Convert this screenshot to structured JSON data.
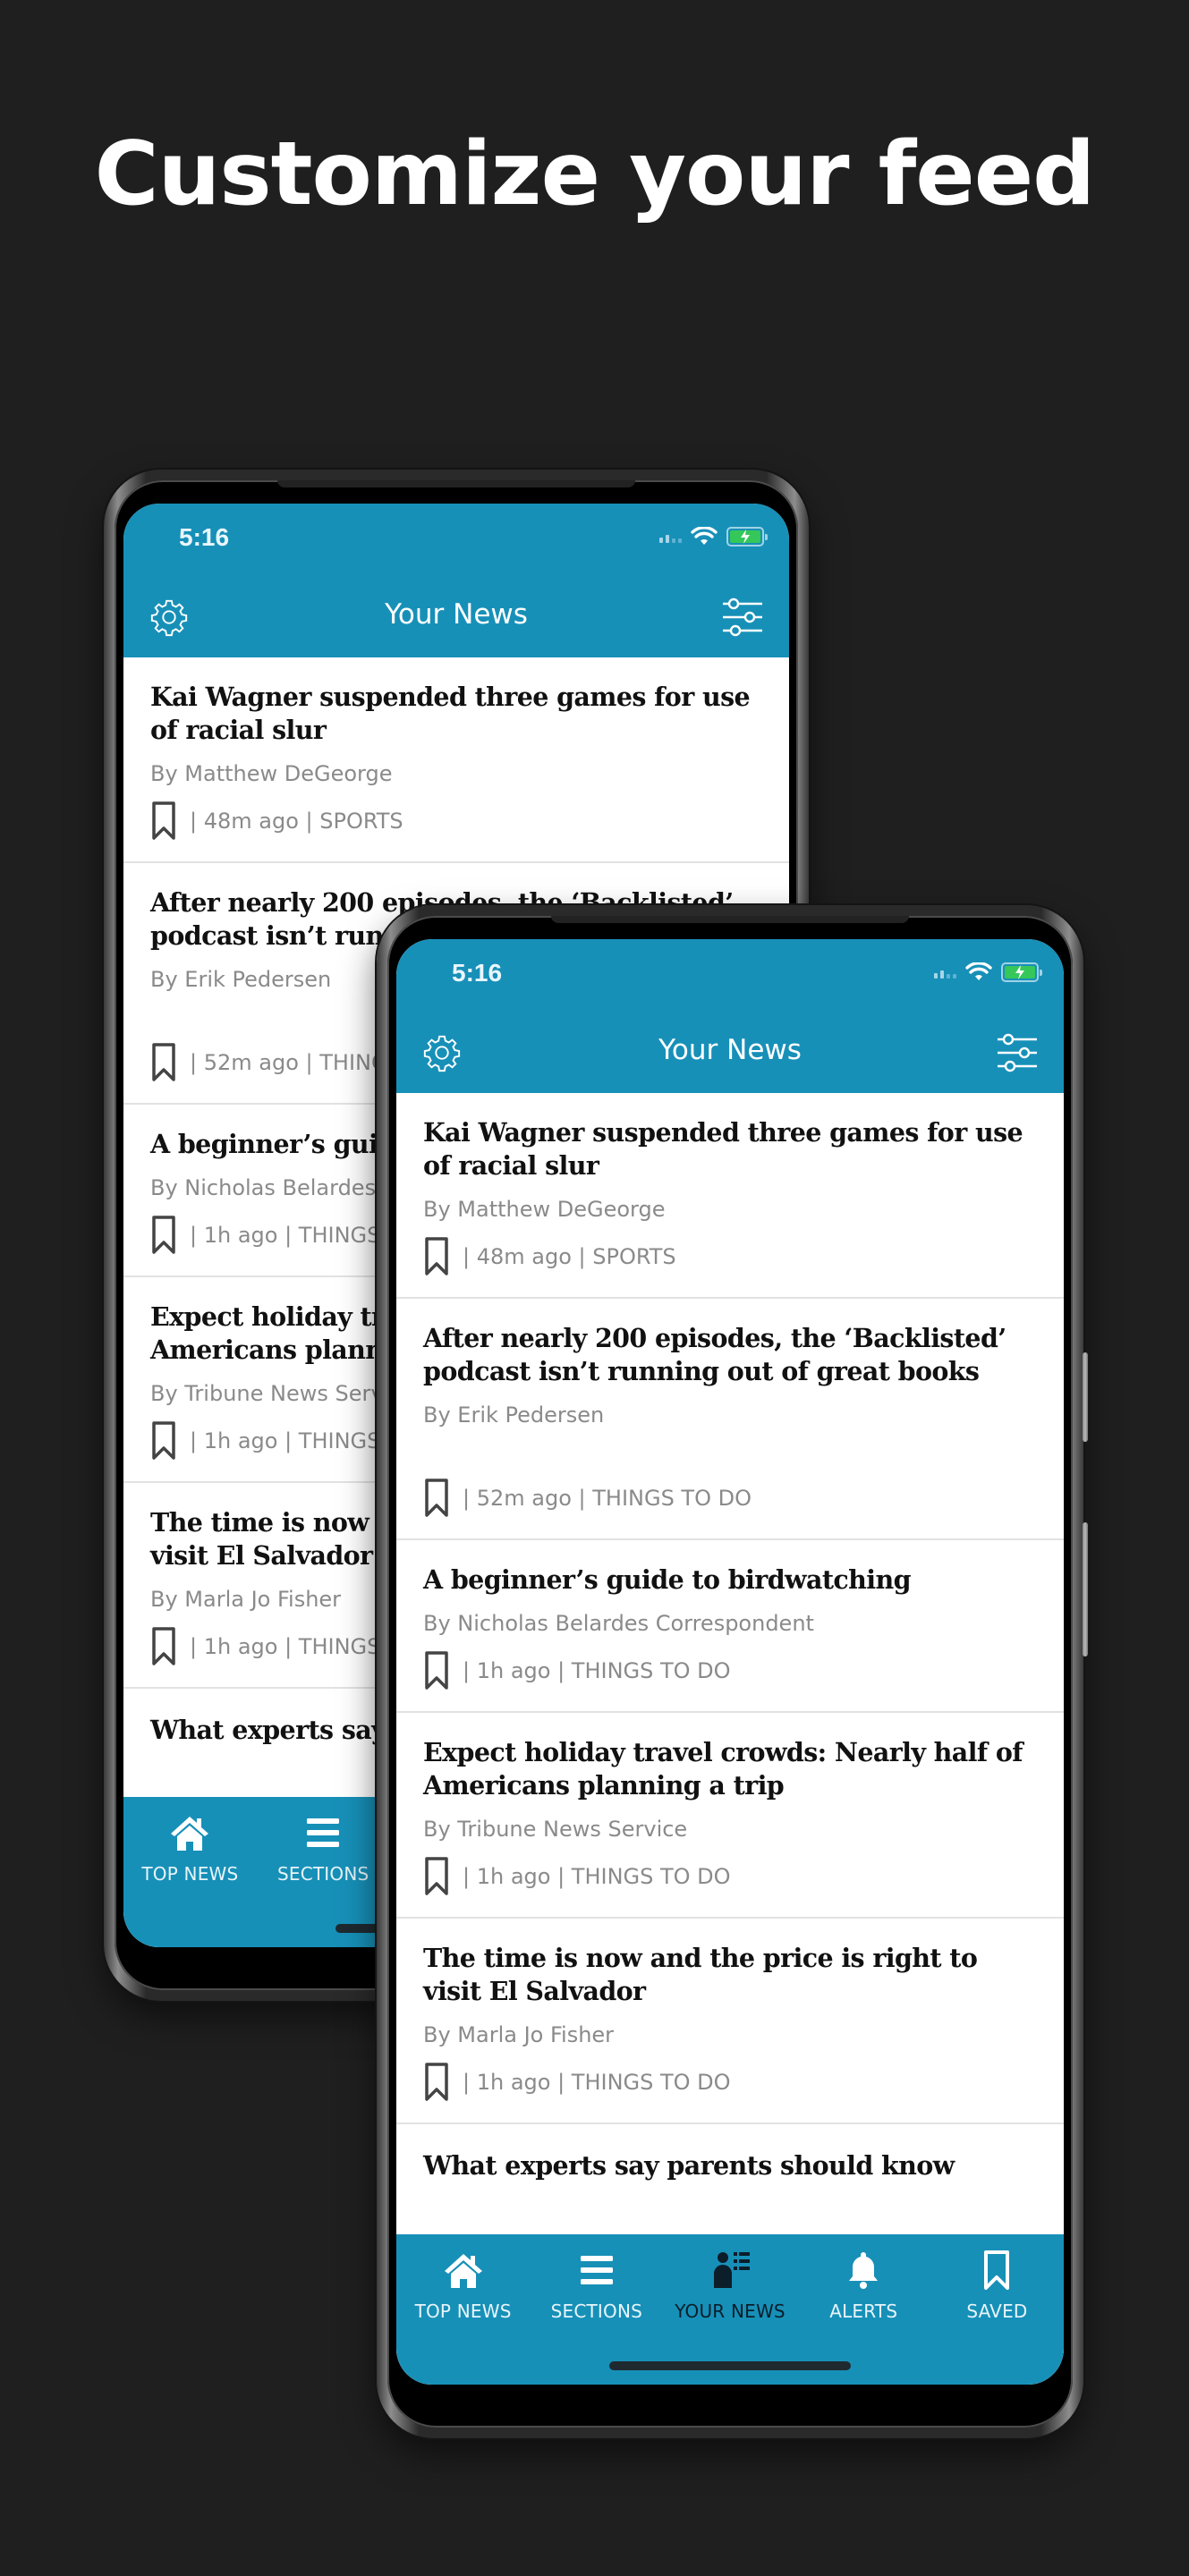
{
  "headline": "Customize your feed",
  "app": {
    "status_time": "5:16",
    "header_title": "Your News",
    "settings_icon": "gear-icon",
    "filter_icon": "sliders-icon",
    "colors": {
      "brand": "#1790b8",
      "background": "#201f20",
      "battery": "#35c759",
      "meta_text": "#8a8a8a",
      "active_tab_text": "#0b1e2a"
    }
  },
  "articles": [
    {
      "title": "Kai Wagner suspended three games for use of racial slur",
      "byline": "By Matthew DeGeorge",
      "meta": "| 48m ago | SPORTS"
    },
    {
      "title": "After nearly 200 episodes, the ‘Backlisted’ podcast isn’t running out of great books",
      "byline": "By Erik Pedersen",
      "meta": "| 52m ago | THINGS TO DO"
    },
    {
      "title": "A beginner’s guide to birdwatching",
      "byline": "By Nicholas Belardes Correspondent",
      "meta": "| 1h ago | THINGS TO DO"
    },
    {
      "title": "Expect holiday travel crowds: Nearly half of Americans planning a trip",
      "byline": "By Tribune News Service",
      "meta": "| 1h ago | THINGS TO DO"
    },
    {
      "title": "The time is now and the price is right to visit El Salvador",
      "byline": "By Marla Jo Fisher",
      "meta": "| 1h ago | THINGS TO DO"
    },
    {
      "title": "What experts say parents should know",
      "byline": "",
      "meta": ""
    }
  ],
  "tabs": [
    {
      "label": "TOP NEWS",
      "icon": "home-icon",
      "active": false
    },
    {
      "label": "SECTIONS",
      "icon": "menu-icon",
      "active": false
    },
    {
      "label": "YOUR NEWS",
      "icon": "person-list-icon",
      "active": true
    },
    {
      "label": "ALERTS",
      "icon": "bell-icon",
      "active": false
    },
    {
      "label": "SAVED",
      "icon": "bookmark-icon",
      "active": false
    }
  ]
}
